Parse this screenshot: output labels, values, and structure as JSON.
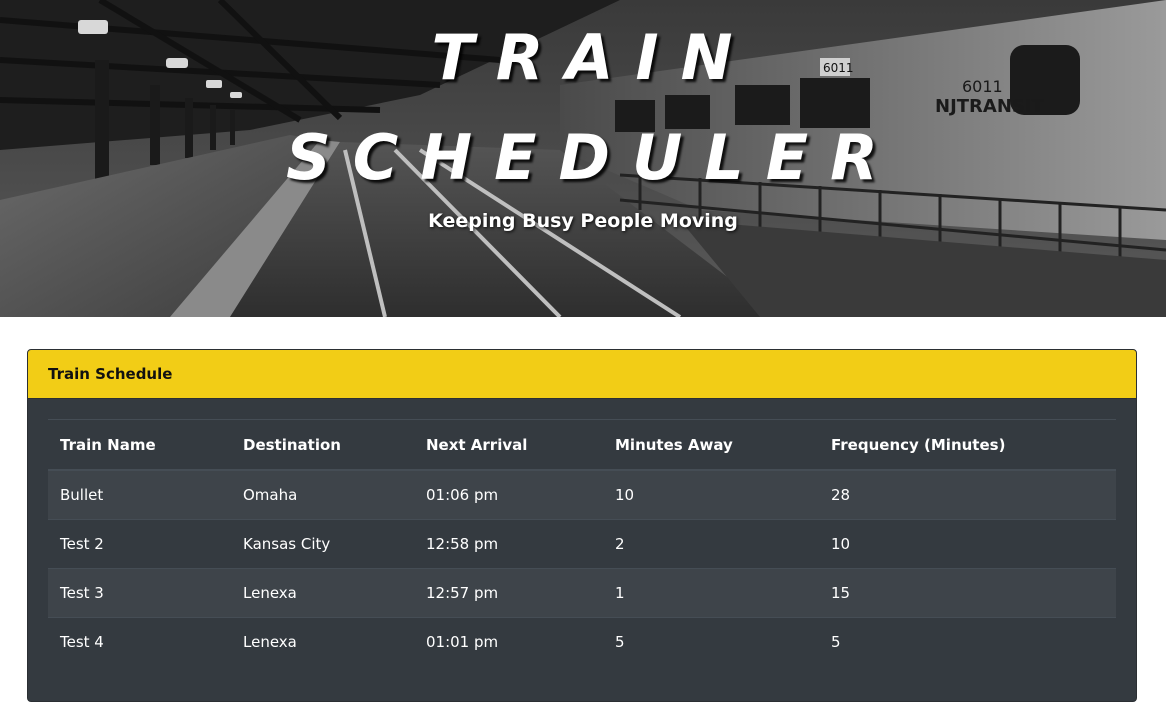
{
  "hero": {
    "title_line1": "TRAIN",
    "title_line2": "SCHEDULER",
    "subtitle": "Keeping Busy People Moving"
  },
  "card": {
    "header": "Train Schedule"
  },
  "table": {
    "columns": [
      "Train Name",
      "Destination",
      "Next Arrival",
      "Minutes Away",
      "Frequency (Minutes)"
    ],
    "rows": [
      [
        "Bullet",
        "Omaha",
        "01:06 pm",
        "10",
        "28"
      ],
      [
        "Test 2",
        "Kansas City",
        "12:58 pm",
        "2",
        "10"
      ],
      [
        "Test 3",
        "Lenexa",
        "12:57 pm",
        "1",
        "15"
      ],
      [
        "Test 4",
        "Lenexa",
        "01:01 pm",
        "5",
        "5"
      ]
    ]
  },
  "colors": {
    "header_accent": "#f2cd16",
    "table_bg": "#343a40",
    "table_stripe": "#3e444a"
  },
  "icons": {
    "hero_image": "train-station-photo"
  }
}
